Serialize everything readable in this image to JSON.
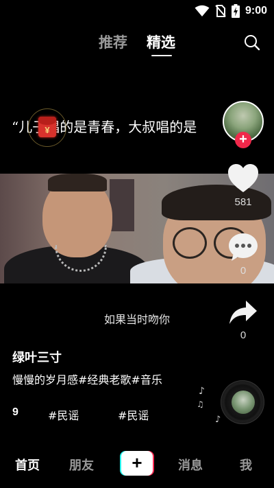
{
  "status_bar": {
    "time": "9:00"
  },
  "top_tabs": {
    "recommended": "推荐",
    "selected": "精选"
  },
  "video": {
    "quote_text": "“儿子唱的是青春，大叔唱的是",
    "subtitle": "如果当时吻你"
  },
  "actions": {
    "like_count": "581",
    "comment_count": "0",
    "share_count": "0"
  },
  "post": {
    "username": "绿叶三寸",
    "description": "慢慢的岁月感#经典老歌#音乐",
    "tag_icon": "9",
    "tags": [
      "#民谣",
      "#民谣"
    ]
  },
  "bottom_nav": {
    "home": "首页",
    "friends": "朋友",
    "add": "+",
    "messages": "消息",
    "me": "我"
  },
  "colors": {
    "accent_red": "#f0284a",
    "tiktok_cyan": "#25f4ee",
    "tiktok_pink": "#fe2c55"
  },
  "icons": [
    "wifi-icon",
    "no-sim-icon",
    "battery-charging-icon",
    "search-icon",
    "red-packet-icon",
    "heart-icon",
    "comment-icon",
    "share-icon",
    "music-disc-icon"
  ]
}
